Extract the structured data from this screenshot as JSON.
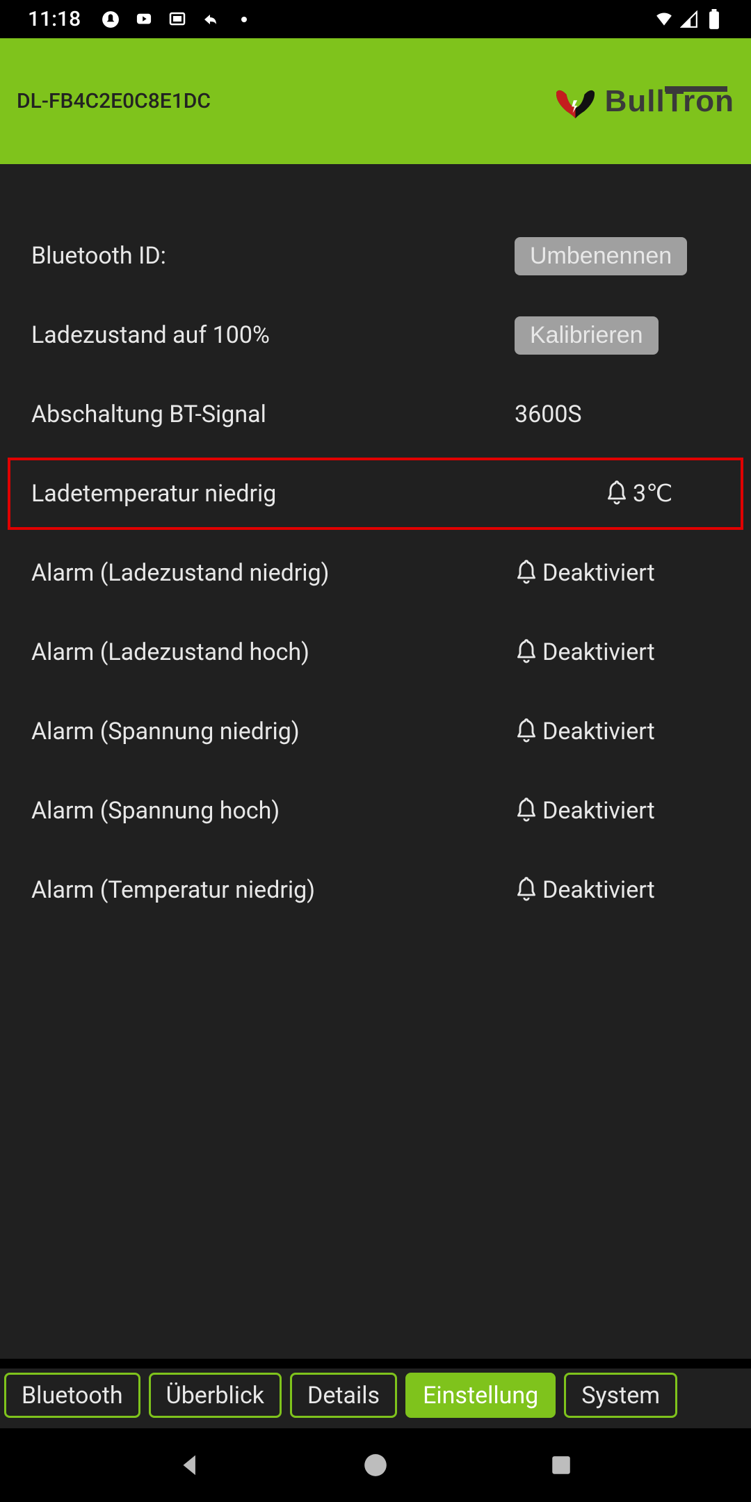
{
  "statusbar": {
    "time": "11:18"
  },
  "header": {
    "device_id": "DL-FB4C2E0C8E1DC",
    "brand": "BullTron"
  },
  "settings": {
    "rows": [
      {
        "label": "Bluetooth ID:",
        "button": "Umbenennen"
      },
      {
        "label": "Ladezustand auf 100%",
        "button": "Kalibrieren"
      },
      {
        "label": "Abschaltung BT-Signal",
        "value": "3600S"
      },
      {
        "label": "Ladetemperatur niedrig",
        "bell": true,
        "value": "3℃",
        "highlighted": true
      },
      {
        "label": "Alarm (Ladezustand niedrig)",
        "bell": true,
        "value": "Deaktiviert"
      },
      {
        "label": "Alarm (Ladezustand hoch)",
        "bell": true,
        "value": "Deaktiviert"
      },
      {
        "label": "Alarm (Spannung niedrig)",
        "bell": true,
        "value": "Deaktiviert"
      },
      {
        "label": "Alarm (Spannung hoch)",
        "bell": true,
        "value": "Deaktiviert"
      },
      {
        "label": "Alarm (Temperatur niedrig)",
        "bell": true,
        "value": "Deaktiviert"
      }
    ]
  },
  "tabs": [
    {
      "label": "Bluetooth",
      "active": false
    },
    {
      "label": "Überblick",
      "active": false
    },
    {
      "label": "Details",
      "active": false
    },
    {
      "label": "Einstellung",
      "active": true
    },
    {
      "label": "System",
      "active": false
    }
  ]
}
